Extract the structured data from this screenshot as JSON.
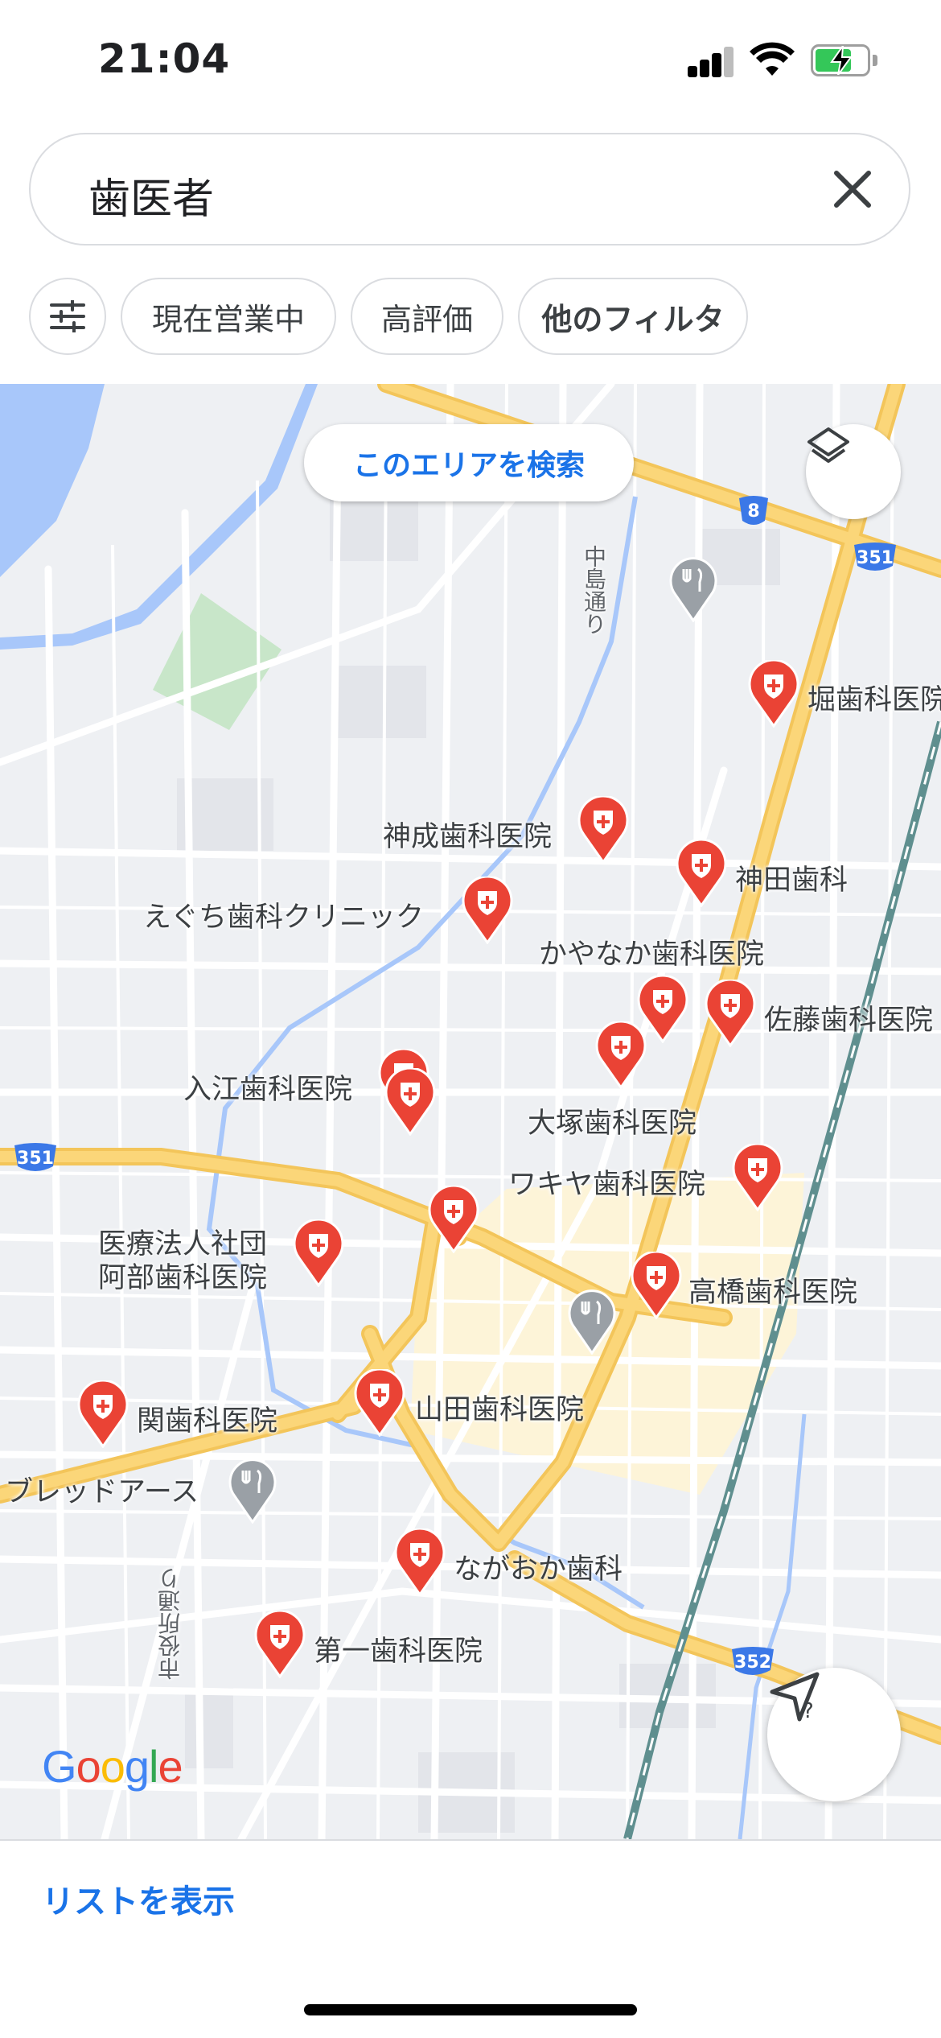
{
  "status_bar": {
    "time": "21:04"
  },
  "search": {
    "query": "歯医者"
  },
  "filters": {
    "options_icon": "tune-icon",
    "chips": [
      "現在営業中",
      "高評価",
      "他のフィルタ"
    ]
  },
  "map": {
    "search_area_button": "このエリアを検索",
    "street_labels": [
      "中島通り",
      "市役所通り"
    ],
    "route_numbers": [
      "8",
      "351",
      "351",
      "352"
    ],
    "poi": "ブレッドアース",
    "dentists": [
      "堀歯科医院",
      "神成歯科医院",
      "神田歯科",
      "えぐち歯科クリニック",
      "かやなか歯科医院",
      "佐藤歯科医院",
      "入江歯科医院",
      "大塚歯科医院",
      "ワキヤ歯科医院",
      "医療法人社団",
      "阿部歯科医院",
      "高橋歯科医院",
      "関歯科医院",
      "山田歯科医院",
      "ながおか歯科",
      "第一歯科医院"
    ],
    "logo": "Google",
    "colors": {
      "pin": "#ea4335",
      "road_major": "#fbd679",
      "water": "#a8c7fa",
      "park": "#c8e6c9"
    }
  },
  "bottom": {
    "list_link": "リストを表示"
  }
}
